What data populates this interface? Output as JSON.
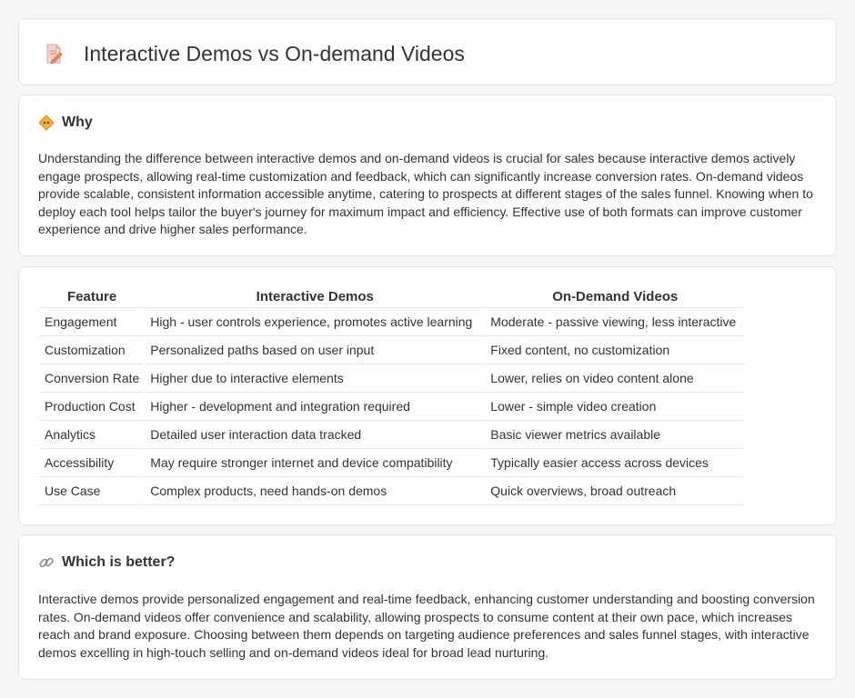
{
  "header": {
    "title": "Interactive Demos vs On-demand Videos",
    "icon": "document-pencil-icon"
  },
  "why": {
    "heading": "Why",
    "icon": "warning-diamond-icon",
    "text": "Understanding the difference between interactive demos and on-demand videos is crucial for sales because interactive demos actively engage prospects, allowing real-time customization and feedback, which can significantly increase conversion rates. On-demand videos provide scalable, consistent information accessible anytime, catering to prospects at different stages of the sales funnel. Knowing when to deploy each tool helps tailor the buyer's journey for maximum impact and efficiency. Effective use of both formats can improve customer experience and drive higher sales performance."
  },
  "table": {
    "headers": [
      "Feature",
      "Interactive Demos",
      "On-Demand Videos"
    ],
    "rows": [
      [
        "Engagement",
        "High - user controls experience, promotes active learning",
        "Moderate - passive viewing, less interactive"
      ],
      [
        "Customization",
        "Personalized paths based on user input",
        "Fixed content, no customization"
      ],
      [
        "Conversion Rate",
        "Higher due to interactive elements",
        "Lower, relies on video content alone"
      ],
      [
        "Production Cost",
        "Higher - development and integration required",
        "Lower - simple video creation"
      ],
      [
        "Analytics",
        "Detailed user interaction data tracked",
        "Basic viewer metrics available"
      ],
      [
        "Accessibility",
        "May require stronger internet and device compatibility",
        "Typically easier access across devices"
      ],
      [
        "Use Case",
        "Complex products, need hands-on demos",
        "Quick overviews, broad outreach"
      ]
    ]
  },
  "better": {
    "heading": "Which is better?",
    "icon": "link-icon",
    "text": "Interactive demos provide personalized engagement and real-time feedback, enhancing customer understanding and boosting conversion rates. On-demand videos offer convenience and scalability, allowing prospects to consume content at their own pace, which increases reach and brand exposure. Choosing between them depends on targeting audience preferences and sales funnel stages, with interactive demos excelling in high-touch selling and on-demand videos ideal for broad lead nurturing."
  },
  "colors": {
    "background": "#f5f6f8",
    "card": "#ffffff",
    "border": "#e3e5e8",
    "text": "#333333",
    "icon_accent": "#f0a030"
  }
}
